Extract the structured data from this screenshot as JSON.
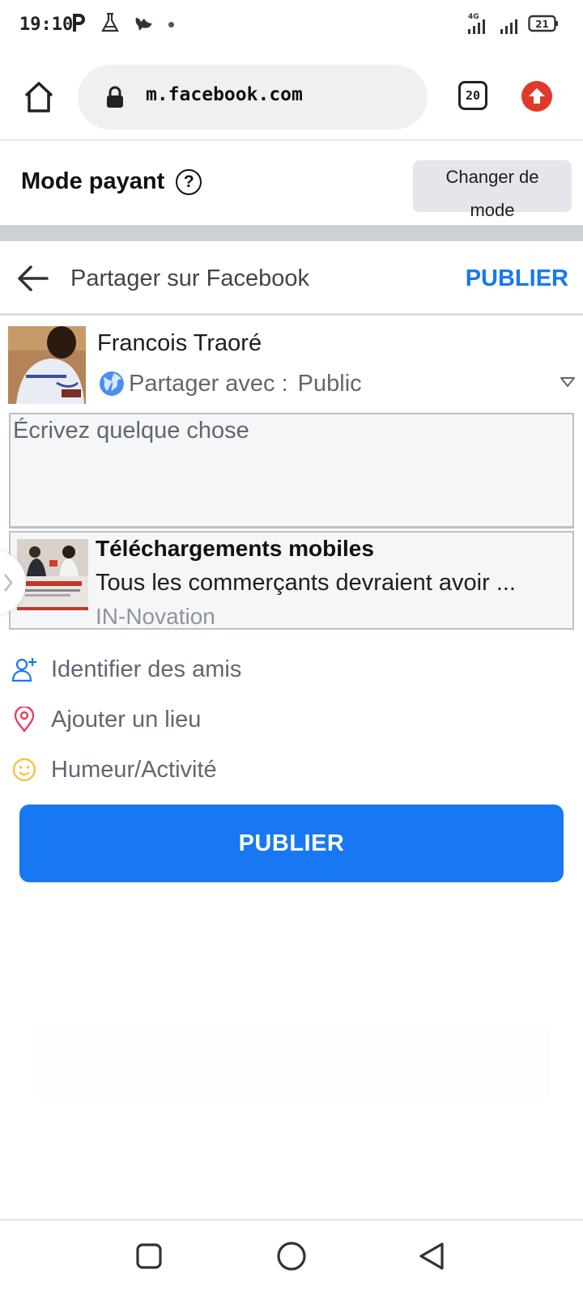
{
  "status_bar": {
    "time": "19:10",
    "network": "4G",
    "battery": "21"
  },
  "browser": {
    "url": "m.facebook.com",
    "tab_count": "20"
  },
  "mode_bar": {
    "title": "Mode payant",
    "help_symbol": "?",
    "change_mode_line1": "Changer de",
    "change_mode_line2": "mode"
  },
  "header": {
    "title": "Partager sur Facebook",
    "publish_label": "PUBLIER"
  },
  "composer": {
    "user_name": "Francois Traoré",
    "audience_label": "Partager avec :",
    "audience_value": "Public",
    "placeholder": "Écrivez quelque chose"
  },
  "link_preview": {
    "title": "Téléchargements mobiles",
    "description": "Tous les commerçants devraient avoir ...",
    "source": "IN-Novation"
  },
  "actions": [
    {
      "label": "Identifier des amis",
      "icon": "tag-friends-icon",
      "color": "#1877f2"
    },
    {
      "label": "Ajouter un lieu",
      "icon": "location-pin-icon",
      "color": "#e4405f"
    },
    {
      "label": "Humeur/Activité",
      "icon": "smiley-icon",
      "color": "#f5c33b"
    }
  ],
  "publish_button": {
    "label": "PUBLIER"
  },
  "colors": {
    "accent": "#1877f2",
    "upload_red": "#e0392b"
  }
}
